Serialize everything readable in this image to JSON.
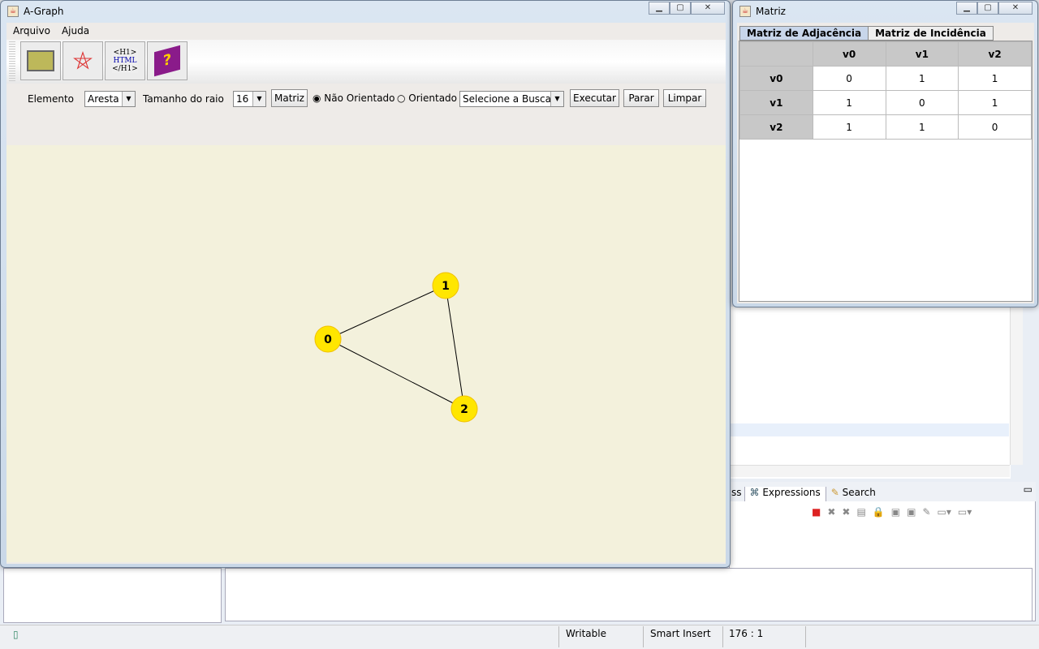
{
  "agraph": {
    "title": "A-Graph",
    "menu": [
      "Arquivo",
      "Ajuda"
    ],
    "toolbar_icons": [
      "open-folder-icon",
      "pentagram-icon",
      "html-icon",
      "help-book-icon"
    ],
    "html_icon_text": [
      "<H1>",
      "HTML",
      "</H1>"
    ],
    "elemento_label": "Elemento",
    "elemento_value": "Aresta",
    "raio_label": "Tamanho do raio",
    "raio_value": "16",
    "matriz_button": "Matriz",
    "radio_nao": "Não Orientado",
    "radio_orientado": "Orientado",
    "nao_orientado_selected": true,
    "busca_value": "Selecione a Busca",
    "executar": "Executar",
    "parar": "Parar",
    "limpar": "Limpar",
    "graph": {
      "nodes": [
        "0",
        "1",
        "2"
      ],
      "edges": [
        [
          "0",
          "1"
        ],
        [
          "1",
          "2"
        ],
        [
          "0",
          "2"
        ]
      ],
      "node_color": "#ffe600",
      "canvas_color": "#f3f1dc"
    }
  },
  "matriz": {
    "title": "Matriz",
    "tabs": [
      "Matriz de Adjacência",
      "Matriz de Incidência"
    ],
    "headers": [
      "",
      "v0",
      "v1",
      "v2"
    ],
    "rows": [
      [
        "v0",
        "0",
        "1",
        "1"
      ],
      [
        "v1",
        "1",
        "0",
        "1"
      ],
      [
        "v2",
        "1",
        "1",
        "0"
      ]
    ]
  },
  "eclipse": {
    "tabs": [
      "ss",
      "Expressions",
      "Search"
    ],
    "status": {
      "writable": "Writable",
      "insert": "Smart Insert",
      "position": "176 : 1"
    }
  }
}
